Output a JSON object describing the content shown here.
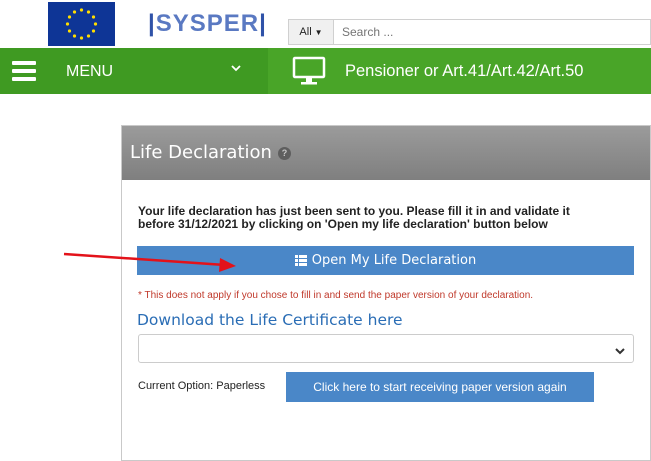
{
  "header": {
    "logo_text": "SYSPER",
    "logo_bar": "|",
    "search_scope": "All",
    "search_placeholder": "Search ..."
  },
  "nav": {
    "menu_label": "MENU",
    "title": "Pensioner or Art.41/Art.42/Art.50"
  },
  "panel": {
    "title": "Life Declaration",
    "notice_line1": "Your life declaration has just been sent to you. Please fill it in and validate it",
    "notice_line2": "before 31/12/2021 by clicking on 'Open my life declaration' button below",
    "open_button_label": "Open My Life Declaration",
    "disclaimer": "* This does not apply if you chose to fill in and send the paper version of your declaration.",
    "download_link": "Download the Life Certificate here",
    "select_value": "",
    "current_option_label": "Current Option: Paperless",
    "paper_button_label": "Click here to start receiving paper version again"
  },
  "colors": {
    "nav_green": "#49a528",
    "button_blue": "#4a87c8",
    "link_blue": "#2a6db5",
    "header_gray": "#8d8d8d",
    "annotation_red": "#e3121a"
  }
}
